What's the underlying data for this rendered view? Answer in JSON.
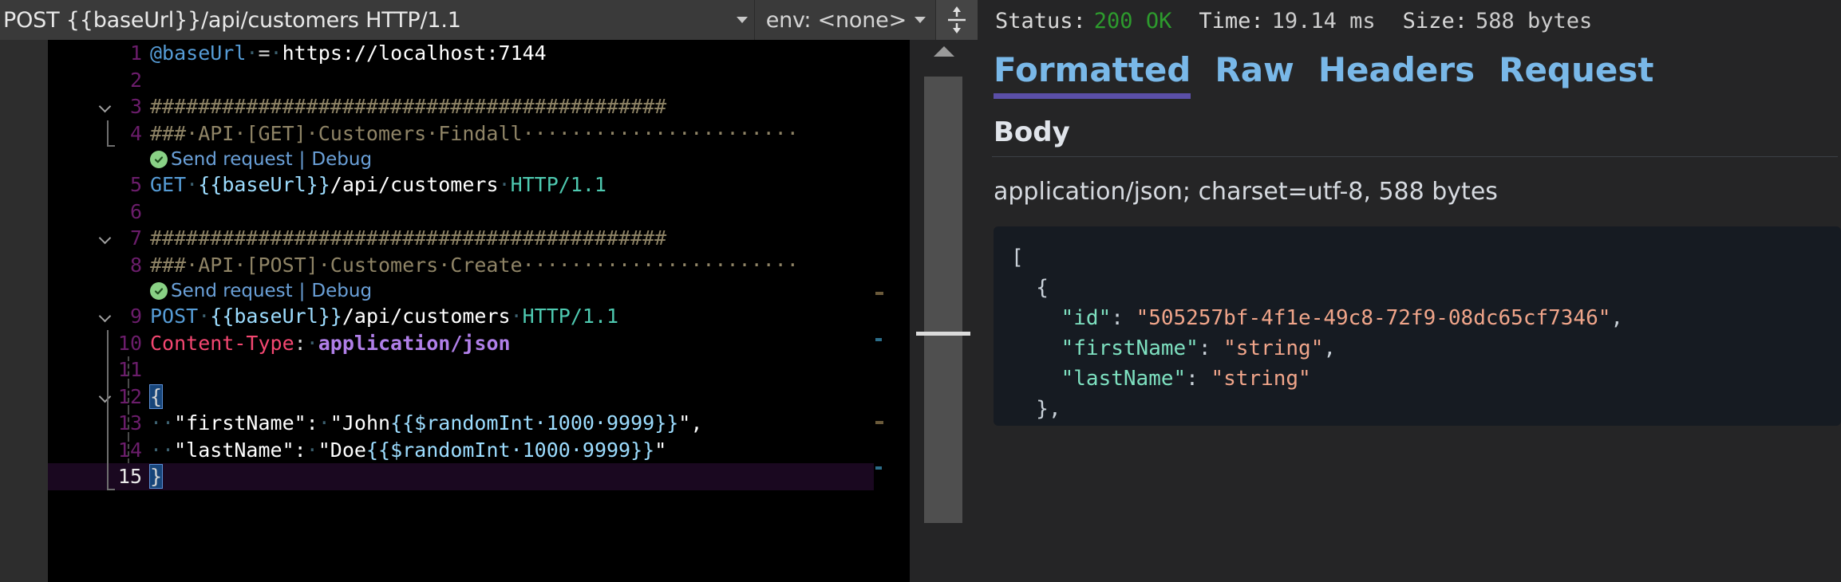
{
  "editor": {
    "header": {
      "url_value": "POST {{baseUrl}}/api/customers HTTP/1.1",
      "url_dropdown_icon": "chevron-down-icon",
      "env_value": "env: <none>",
      "env_dropdown_icon": "chevron-down-icon",
      "split_icon": "split-editor-vertical-icon"
    },
    "codelens": {
      "send_request_label": "Send request",
      "separator": "|",
      "debug_label": "Debug",
      "status_icon": "check-circle-icon"
    },
    "lines": [
      {
        "num": "1",
        "tokens": [
          {
            "t": "@baseUrl",
            "c": "t-var"
          },
          {
            "t": "·",
            "c": "t-dot"
          },
          {
            "t": "=",
            "c": "t-op"
          },
          {
            "t": "·",
            "c": "t-dot"
          },
          {
            "t": "https://localhost:7144",
            "c": "t-url"
          }
        ]
      },
      {
        "num": "2",
        "tokens": []
      },
      {
        "num": "3",
        "tokens": [
          {
            "t": "###########################################",
            "c": "t-comment"
          }
        ]
      },
      {
        "num": "4",
        "tokens": [
          {
            "t": "###·API·[GET]·Customers·Findall·······················",
            "c": "t-comment"
          }
        ]
      },
      {
        "num": "5",
        "tokens": [
          {
            "t": "GET",
            "c": "t-method"
          },
          {
            "t": "·",
            "c": "t-dot"
          },
          {
            "t": "{{baseUrl}}",
            "c": "t-tmpl"
          },
          {
            "t": "/api/customers",
            "c": "t-url"
          },
          {
            "t": "·",
            "c": "t-dot"
          },
          {
            "t": "HTTP/1.1",
            "c": "t-ver"
          }
        ]
      },
      {
        "num": "6",
        "tokens": []
      },
      {
        "num": "7",
        "tokens": [
          {
            "t": "###########################################",
            "c": "t-comment"
          }
        ]
      },
      {
        "num": "8",
        "tokens": [
          {
            "t": "###·API·[POST]·Customers·Create·······················",
            "c": "t-comment"
          }
        ]
      },
      {
        "num": "9",
        "tokens": [
          {
            "t": "POST",
            "c": "t-method"
          },
          {
            "t": "·",
            "c": "t-dot"
          },
          {
            "t": "{{baseUrl}}",
            "c": "t-tmpl"
          },
          {
            "t": "/api/customers",
            "c": "t-url"
          },
          {
            "t": "·",
            "c": "t-dot"
          },
          {
            "t": "HTTP/1.1",
            "c": "t-ver"
          }
        ]
      },
      {
        "num": "10",
        "tokens": [
          {
            "t": "Content-Type",
            "c": "t-hkey"
          },
          {
            "t": ":",
            "c": "t-op"
          },
          {
            "t": "·",
            "c": "t-dot"
          },
          {
            "t": "application/json",
            "c": "t-hval"
          }
        ]
      },
      {
        "num": "11",
        "tokens": []
      },
      {
        "num": "12",
        "tokens": [
          {
            "t": "{",
            "c": "t-brace-hl"
          }
        ]
      },
      {
        "num": "13",
        "tokens": [
          {
            "t": "··",
            "c": "t-dot"
          },
          {
            "t": "\"firstName\":",
            "c": "t-jstr"
          },
          {
            "t": "·",
            "c": "t-dot"
          },
          {
            "t": "\"John",
            "c": "t-jstr"
          },
          {
            "t": "{{$randomInt·1000·9999}}",
            "c": "t-tmpl"
          },
          {
            "t": "\",",
            "c": "t-jstr"
          }
        ]
      },
      {
        "num": "14",
        "tokens": [
          {
            "t": "··",
            "c": "t-dot"
          },
          {
            "t": "\"lastName\":",
            "c": "t-jstr"
          },
          {
            "t": "·",
            "c": "t-dot"
          },
          {
            "t": "\"Doe",
            "c": "t-jstr"
          },
          {
            "t": "{{$randomInt·1000·9999}}",
            "c": "t-tmpl"
          },
          {
            "t": "\"",
            "c": "t-jstr"
          }
        ]
      },
      {
        "num": "15",
        "tokens": [
          {
            "t": "}",
            "c": "t-brace-hl"
          }
        ],
        "active": true
      }
    ],
    "scrollbar": {
      "up_arrow_icon": "scroll-up-arrow-icon"
    }
  },
  "response": {
    "status": {
      "status_label": "Status:",
      "status_value": "200 OK",
      "status_color": "#2d9b2d",
      "time_label": "Time:",
      "time_value": "19.14 ms",
      "size_label": "Size:",
      "size_value": "588 bytes"
    },
    "tabs": [
      {
        "label": "Formatted",
        "active": true
      },
      {
        "label": "Raw",
        "active": false
      },
      {
        "label": "Headers",
        "active": false
      },
      {
        "label": "Request",
        "active": false
      }
    ],
    "active_tab_underline_color": "#5b4fa8",
    "body_heading": "Body",
    "content_type": "application/json; charset=utf-8, 588 bytes",
    "json_lines": [
      [
        {
          "t": "[",
          "c": "j-punct"
        }
      ],
      [
        {
          "t": "  {",
          "c": "j-punct"
        }
      ],
      [
        {
          "t": "    ",
          "c": "j-punct"
        },
        {
          "t": "\"id\"",
          "c": "j-key"
        },
        {
          "t": ": ",
          "c": "j-punct"
        },
        {
          "t": "\"505257bf-4f1e-49c8-72f9-08dc65cf7346\"",
          "c": "j-str"
        },
        {
          "t": ",",
          "c": "j-punct"
        }
      ],
      [
        {
          "t": "    ",
          "c": "j-punct"
        },
        {
          "t": "\"firstName\"",
          "c": "j-key"
        },
        {
          "t": ": ",
          "c": "j-punct"
        },
        {
          "t": "\"string\"",
          "c": "j-str"
        },
        {
          "t": ",",
          "c": "j-punct"
        }
      ],
      [
        {
          "t": "    ",
          "c": "j-punct"
        },
        {
          "t": "\"lastName\"",
          "c": "j-key"
        },
        {
          "t": ": ",
          "c": "j-punct"
        },
        {
          "t": "\"string\"",
          "c": "j-str"
        }
      ],
      [
        {
          "t": "  },",
          "c": "j-punct"
        }
      ]
    ]
  }
}
